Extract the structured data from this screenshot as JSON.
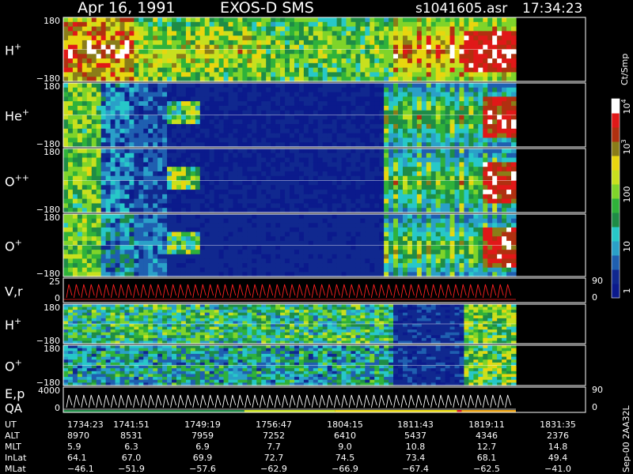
{
  "header": {
    "date": "Apr 16, 1991",
    "mission": "EXOS-D SMS",
    "file": "s1041605.asr",
    "time": "17:34:23"
  },
  "colorbar": {
    "unit": "Ct/Smp",
    "ticks": [
      "1",
      "10",
      "100",
      "10",
      "10"
    ],
    "tick_exponents": [
      "",
      "",
      "",
      "3",
      "4"
    ]
  },
  "chart_data": {
    "type": "heatmap",
    "panels": [
      {
        "label": "H",
        "superscript": "+",
        "kind": "spectrogram",
        "ylim": [
          -180,
          180
        ],
        "ticks": [
          "180",
          "−180"
        ],
        "pattern": "h_main"
      },
      {
        "label": "He",
        "superscript": "+",
        "kind": "spectrogram",
        "ylim": [
          -180,
          180
        ],
        "ticks": [
          "180",
          "−180"
        ],
        "pattern": "he"
      },
      {
        "label": "O",
        "superscript": "++",
        "kind": "spectrogram",
        "ylim": [
          -180,
          180
        ],
        "ticks": [
          "180",
          "−180"
        ],
        "pattern": "opp"
      },
      {
        "label": "O",
        "superscript": "+",
        "kind": "spectrogram",
        "ylim": [
          -180,
          180
        ],
        "ticks": [
          "180",
          "−180"
        ],
        "pattern": "op"
      },
      {
        "label": "V,r",
        "superscript": "",
        "kind": "line",
        "left_ticks": [
          "25",
          "0"
        ],
        "right_ticks": [
          "90",
          "0"
        ],
        "color": "#ff2020"
      },
      {
        "label": "H",
        "superscript": "+",
        "kind": "spectrogram",
        "ylim": [
          -180,
          180
        ],
        "ticks": [
          "180",
          "−180"
        ],
        "pattern": "h_low"
      },
      {
        "label": "O",
        "superscript": "+",
        "kind": "spectrogram",
        "ylim": [
          -180,
          180
        ],
        "ticks": [
          "180",
          "−180"
        ],
        "pattern": "o_low"
      },
      {
        "label": "E,p",
        "label2": "QA",
        "superscript": "",
        "kind": "line",
        "left_ticks": [
          "4000",
          "0"
        ],
        "right_ticks": [
          "90",
          "0"
        ],
        "color": "#ffffff"
      }
    ],
    "x_axis": {
      "rows": [
        {
          "label": "UT",
          "values": [
            "1734:23",
            "1741:51",
            "1749:19",
            "1756:47",
            "1804:15",
            "1811:43",
            "1819:11",
            "1831:35"
          ]
        },
        {
          "label": "ALT",
          "values": [
            "8970",
            "8531",
            "7959",
            "7252",
            "6410",
            "5437",
            "4346",
            "2376"
          ]
        },
        {
          "label": "MLT",
          "values": [
            "5.9",
            "6.3",
            "6.9",
            "7.7",
            "9.0",
            "10.8",
            "12.7",
            "14.8"
          ]
        },
        {
          "label": "InLat",
          "values": [
            "64.1",
            "67.0",
            "69.9",
            "72.7",
            "74.5",
            "73.4",
            "68.1",
            "49.4"
          ]
        },
        {
          "label": "MLat",
          "values": [
            "−46.1",
            "−51.9",
            "−57.6",
            "−62.9",
            "−66.9",
            "−67.4",
            "−62.5",
            "−41.0"
          ]
        }
      ]
    }
  },
  "footer": {
    "stamp": "Sep-00 2AA32L"
  }
}
